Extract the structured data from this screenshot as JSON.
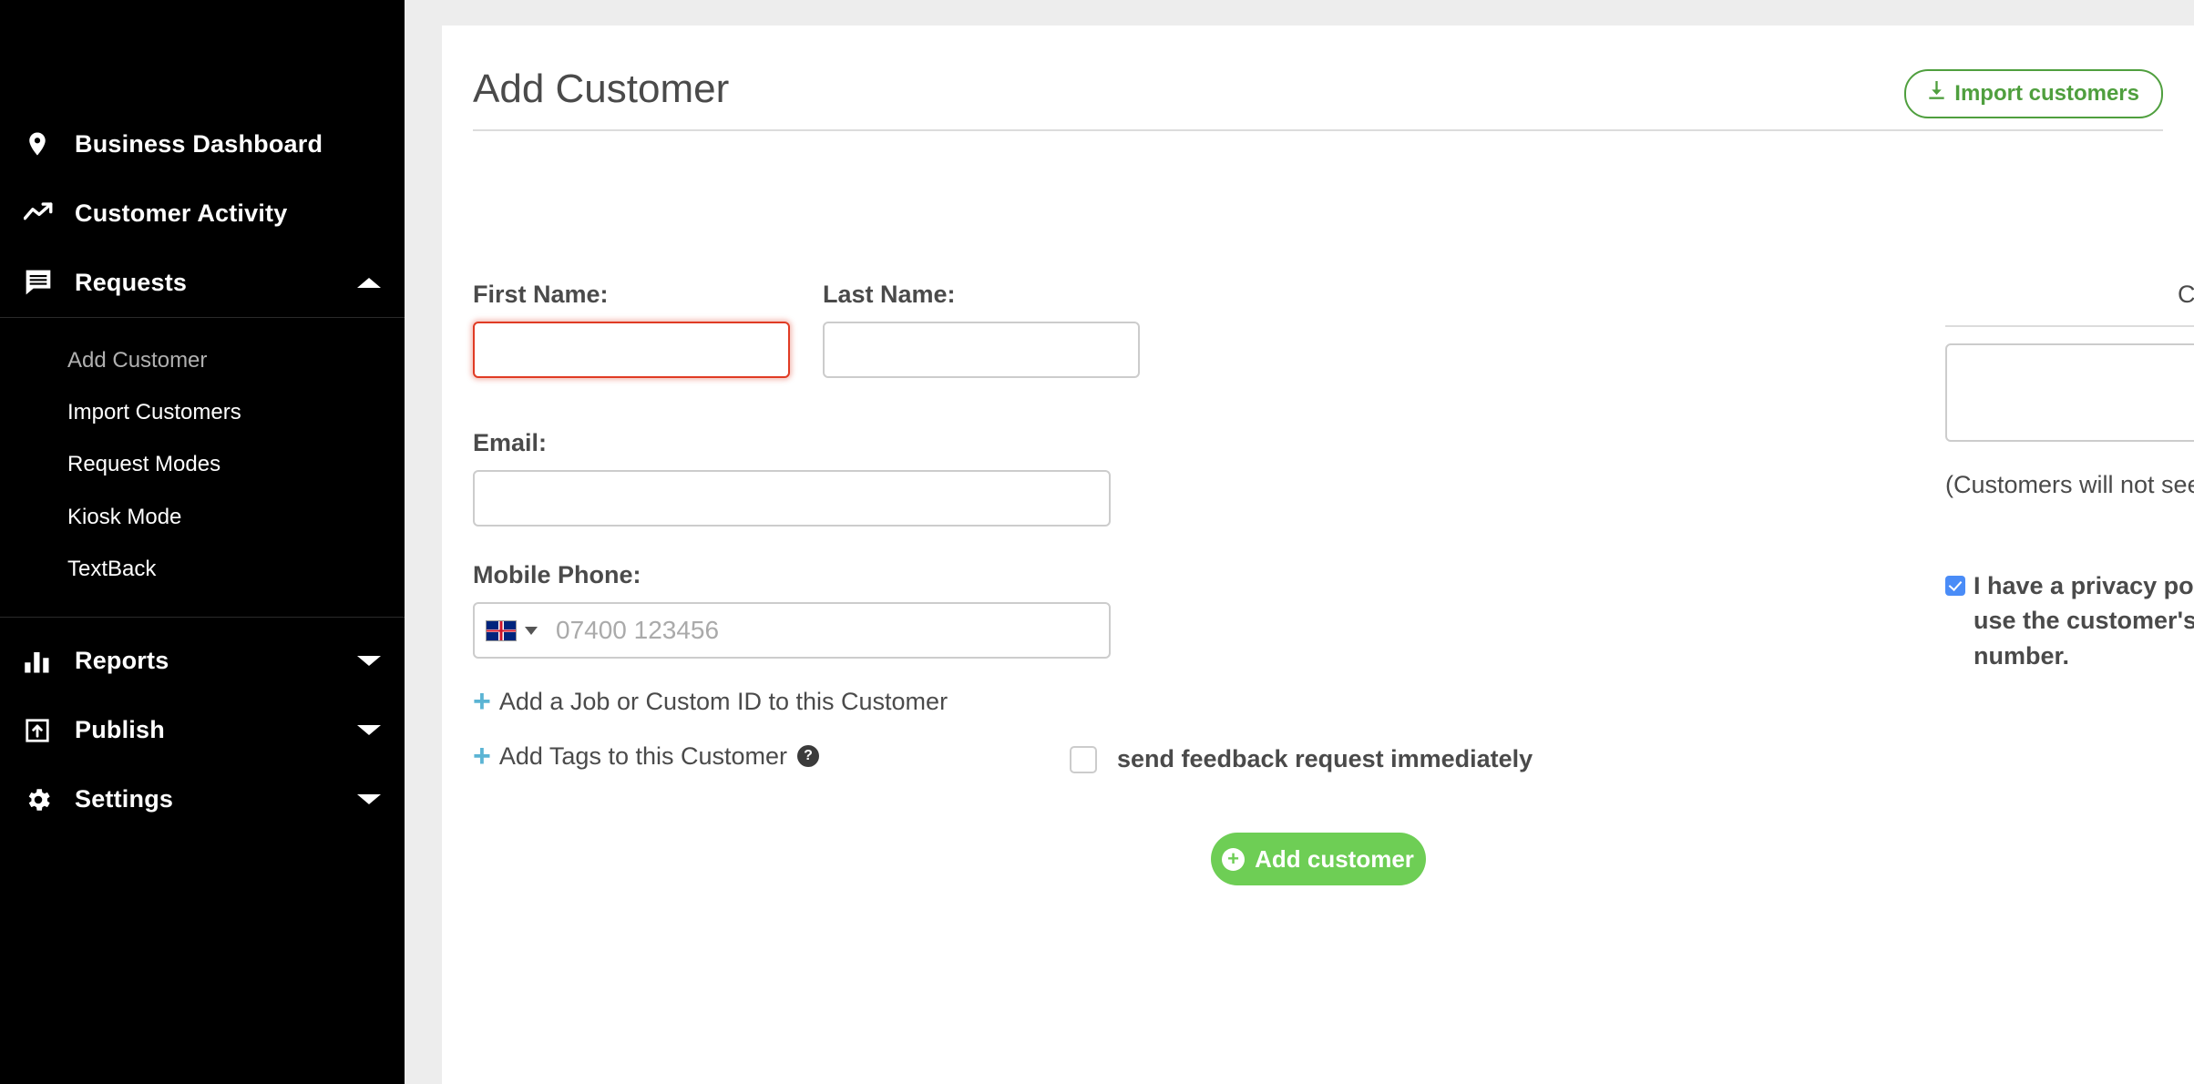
{
  "sidebar": {
    "top_items": [
      {
        "label": "Business Dashboard",
        "icon": "location-pin-icon",
        "has_caret": false,
        "caret": ""
      },
      {
        "label": "Customer Activity",
        "icon": "trending-up-icon",
        "has_caret": false,
        "caret": ""
      },
      {
        "label": "Requests",
        "icon": "message-lines-icon",
        "has_caret": true,
        "caret": "up"
      }
    ],
    "submenu": [
      {
        "label": "Add Customer",
        "active": true
      },
      {
        "label": "Import Customers",
        "active": false
      },
      {
        "label": "Request Modes",
        "active": false
      },
      {
        "label": "Kiosk Mode",
        "active": false
      },
      {
        "label": "TextBack",
        "active": false
      }
    ],
    "lower_items": [
      {
        "label": "Reports",
        "icon": "bar-chart-icon",
        "has_caret": true,
        "caret": "down"
      },
      {
        "label": "Publish",
        "icon": "publish-upload-icon",
        "has_caret": true,
        "caret": "down"
      },
      {
        "label": "Settings",
        "icon": "gear-icon",
        "has_caret": true,
        "caret": "down"
      }
    ]
  },
  "header": {
    "title": "Add Customer",
    "import_button_label": "Import customers",
    "import_button_icon": "download-icon",
    "accent_green": "#4f9f3e"
  },
  "form": {
    "first_name": {
      "label": "First Name:",
      "value": "",
      "placeholder": "",
      "error": true
    },
    "last_name": {
      "label": "Last Name:",
      "value": "",
      "placeholder": ""
    },
    "email": {
      "label": "Email:",
      "value": "",
      "placeholder": ""
    },
    "mobile_phone": {
      "label": "Mobile Phone:",
      "value": "",
      "placeholder": "07400 123456",
      "country_flag": "uk-flag-icon"
    },
    "add_job_link": {
      "label": "Add a Job or Custom ID to this Customer",
      "icon": "plus-icon"
    },
    "add_tags_link": {
      "label": "Add Tags to this Customer",
      "icon": "plus-icon",
      "help_icon": "question-mark-icon",
      "help_glyph": "?"
    },
    "send_feedback": {
      "label": "send feedback request immediately",
      "checked": false
    },
    "submit_button": {
      "label": "Add customer",
      "icon": "circle-plus-icon",
      "color": "#6ece55"
    }
  },
  "notes_panel": {
    "title": "Customer Notes",
    "textarea_value": "",
    "textarea_placeholder": "",
    "hint": "(Customers will not see your notes. Only visible to you.)",
    "privacy_checkbox": {
      "label": "I have a privacy policy in place, and permission to use the customer's email address and phone number.",
      "checked": true,
      "color": "#4a8cf7"
    }
  }
}
